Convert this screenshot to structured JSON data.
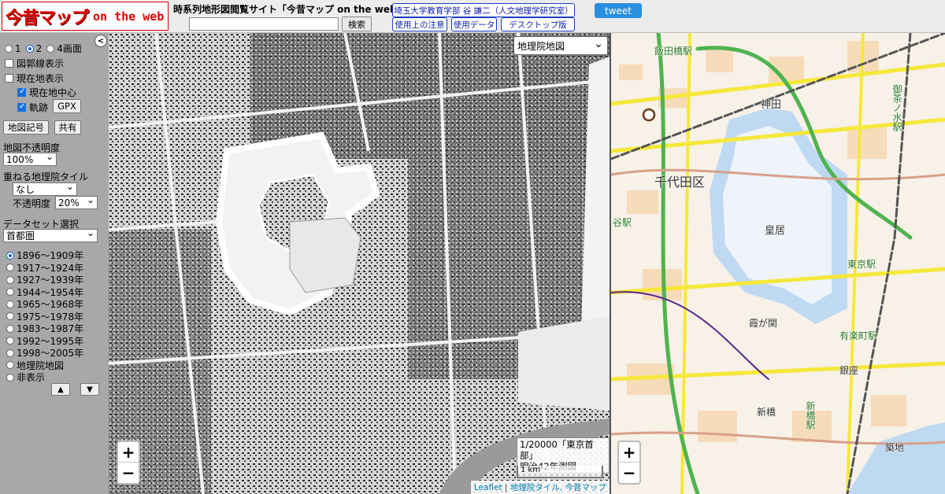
{
  "header": {
    "logo_jp": "今昔マップ",
    "logo_en": "on the web",
    "site_title": "時系列地形図閲覧サイト「今昔マップ on the web」",
    "search_placeholder": "",
    "search_button": "検索",
    "author_link": "埼玉大学教育学部 谷 謙二（人文地理学研究室）",
    "notes_link": "使用上の注意",
    "data_link": "使用データ",
    "desktop_link": "デスクトップ版",
    "tweet_button": "tweet"
  },
  "sidebar": {
    "view_options": [
      "1",
      "2",
      "4画面"
    ],
    "view_selected": 1,
    "grid_toggle": "図郭線表示",
    "current_location": "現在地表示",
    "center_location": "現在地中心",
    "track": "軌跡",
    "gpx_button": "GPX",
    "legend_button": "地図記号",
    "share_button": "共有",
    "opacity_label": "地図不透明度",
    "opacity_value": "100%",
    "overlay_label": "重ねる地理院タイル",
    "overlay_value": "なし",
    "overlay_opacity_label": "不透明度",
    "overlay_opacity_value": "20%",
    "dataset_label": "データセット選択",
    "dataset_value": "首都圏",
    "periods": [
      "1896～1909年",
      "1917～1924年",
      "1927～1939年",
      "1944～1954年",
      "1965～1968年",
      "1975～1978年",
      "1983～1987年",
      "1992～1995年",
      "1998～2005年",
      "地理院地図",
      "非表示"
    ],
    "period_selected": 0,
    "up_button": "▲",
    "down_button": "▼"
  },
  "map_left": {
    "layer_select": "地理院地図",
    "caption_line1": "1/20000「東京首部」",
    "caption_line2": "明治42年測図",
    "scale": "1 km",
    "zoom_in": "+",
    "zoom_out": "−",
    "attribution_leaflet": "Leaflet",
    "attribution_sep": "|",
    "attribution_tiles": "地理院タイル, 今昔マップ"
  },
  "map_right": {
    "zoom_in": "+",
    "zoom_out": "−",
    "labels": [
      "飯田橋駅",
      "神田",
      "御茶ノ水駅",
      "千代田区",
      "皇居",
      "東京駅",
      "有楽町駅",
      "霞が関",
      "銀座",
      "新橋",
      "新橋駅",
      "築地",
      "谷駅"
    ]
  },
  "colors": {
    "logo_red": "#e00000",
    "link_blue": "#1a3cc9",
    "tweet_blue": "#2b8fe0",
    "moat_water": "#bfd9f2",
    "road_yellow": "#f5e83a",
    "road_green": "#4fb34f",
    "rail_gray": "#555555"
  }
}
